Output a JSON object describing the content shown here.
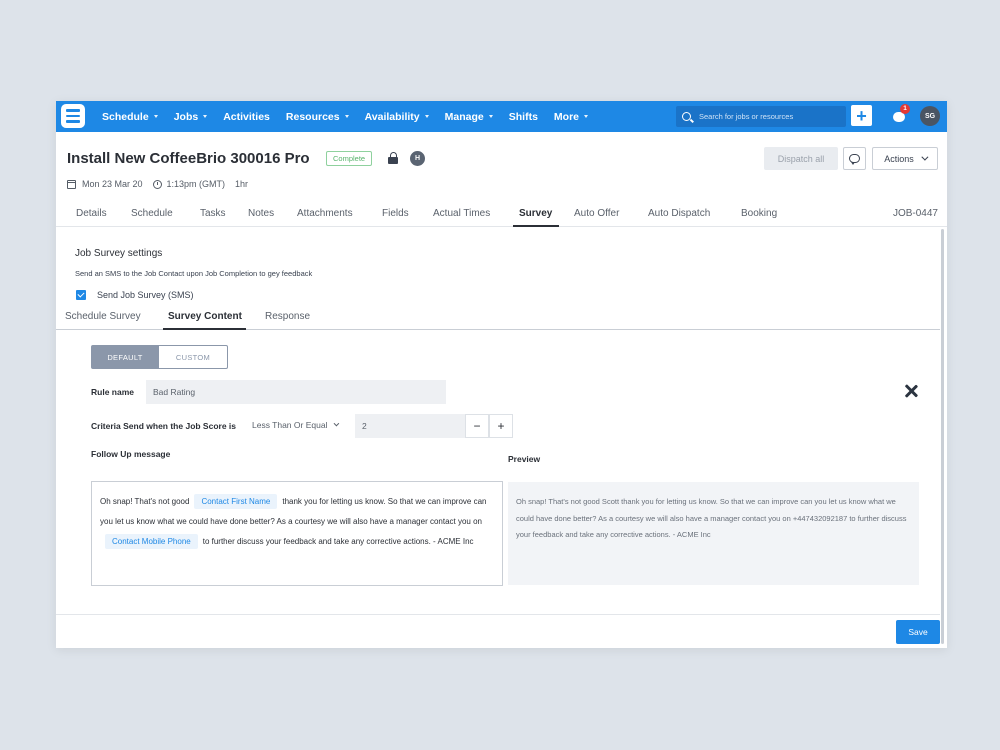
{
  "nav": {
    "items": [
      {
        "label": "Schedule",
        "caret": true
      },
      {
        "label": "Jobs",
        "caret": true
      },
      {
        "label": "Activities",
        "caret": false
      },
      {
        "label": "Resources",
        "caret": true
      },
      {
        "label": "Availability",
        "caret": true
      },
      {
        "label": "Manage",
        "caret": true
      },
      {
        "label": "Shifts",
        "caret": false
      },
      {
        "label": "More",
        "caret": true
      }
    ],
    "search_placeholder": "Search for jobs or resources",
    "add_label": "+",
    "notification_count": "1",
    "user_initials": "SG",
    "accent_color": "#1e88e5"
  },
  "job": {
    "title": "Install New CoffeeBrio 300016 Pro",
    "status": "Complete",
    "assignee_initial": "H",
    "date": "Mon 23 Mar 20",
    "time": "1:13pm (GMT)",
    "duration": "1hr",
    "id": "JOB-0447"
  },
  "header_actions": {
    "dispatch_all": "Dispatch all",
    "actions": "Actions"
  },
  "tabs": [
    "Details",
    "Schedule",
    "Tasks",
    "Notes",
    "Attachments",
    "Fields",
    "Actual Times",
    "Survey",
    "Auto Offer",
    "Auto Dispatch",
    "Booking"
  ],
  "active_tab": "Survey",
  "survey": {
    "settings_title": "Job Survey settings",
    "settings_desc": "Send an SMS to the Job Contact upon Job Completion to gey feedback",
    "send_label": "Send Job Survey (SMS)",
    "send_checked": true,
    "subtabs": [
      "Schedule Survey",
      "Survey Content",
      "Response"
    ],
    "active_subtab": "Survey Content",
    "mode_default": "DEFAULT",
    "mode_custom": "CUSTOM",
    "rule_name_label": "Rule name",
    "rule_name_value": "Bad Rating",
    "criteria_label": "Criteria Send when the Job Score is",
    "criteria_operator": "Less Than Or Equal",
    "criteria_value": "2",
    "minus": "−",
    "plus": "+",
    "followup_label": "Follow Up message",
    "preview_label": "Preview",
    "message": {
      "part1": "Oh snap! That's not good",
      "token1": "Contact First Name",
      "part2": "thank you for letting us know. So that we can improve can you let us know what we could have done better? As a courtesy we will also have a manager contact you on",
      "token2": "Contact Mobile Phone",
      "part3": "to further discuss your feedback and take any corrective actions. - ACME Inc"
    },
    "preview_text": "Oh snap! That's not good Scott thank you for letting us know. So that we can improve can you let us know what we could have done better? As a courtesy we will also have a manager contact you on +447432092187 to further discuss your feedback and take any corrective actions. - ACME Inc",
    "save_label": "Save"
  }
}
